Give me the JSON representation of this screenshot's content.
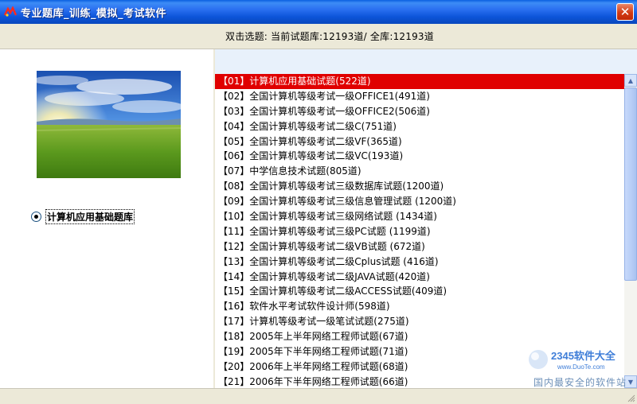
{
  "window": {
    "title": "专业题库_训练_模拟_考试软件",
    "app_icon": "app-logo-icon",
    "close_icon": "close-icon"
  },
  "info": {
    "text": "双击选题:  当前试题库:12193道/  全库:12193道"
  },
  "sidebar": {
    "image": "landscape-grass-sky",
    "radio_label": "计算机应用基础题库",
    "radio_checked": true
  },
  "list": {
    "selected_index": 0,
    "items": [
      "【01】计算机应用基础试题(522道)",
      "【02】全国计算机等级考试一级OFFICE1(491道)",
      "【03】全国计算机等级考试一级OFFICE2(506道)",
      "【04】全国计算机等级考试二级C(751道)",
      "【05】全国计算机等级考试二级VF(365道)",
      "【06】全国计算机等级考试二级VC(193道)",
      "【07】中学信息技术试题(805道)",
      "【08】全国计算机等级考试三级数据库试题(1200道)",
      "【09】全国计算机等级考试三级信息管理试题 (1200道)",
      "【10】全国计算机等级考试三级网络试题 (1434道)",
      "【11】全国计算机等级考试三级PC试题 (1199道)",
      "【12】全国计算机等级考试二级VB试题 (672道)",
      "【13】全国计算机等级考试二级Cplus试题 (416道)",
      "【14】全国计算机等级考试二级JAVA试题(420道)",
      "【15】全国计算机等级考试二级ACCESS试题(409道)",
      "【16】软件水平考试软件设计师(598道)",
      "【17】计算机等级考试一级笔试试题(275道)",
      "【18】2005年上半年网络工程师试题(67道)",
      "【19】2005年下半年网络工程师试题(71道)",
      "【20】2006年上半年网络工程师试题(68道)",
      "【21】2006年下半年网络工程师试题(66道)"
    ]
  },
  "watermark": {
    "logo_text": "2345软件大全",
    "url": "www.DuoTe.com",
    "slogan": "国内最安全的软件站"
  },
  "colors": {
    "titlebar": "#0d55d9",
    "selection": "#e00000",
    "panel_bg": "#ece9d8"
  }
}
